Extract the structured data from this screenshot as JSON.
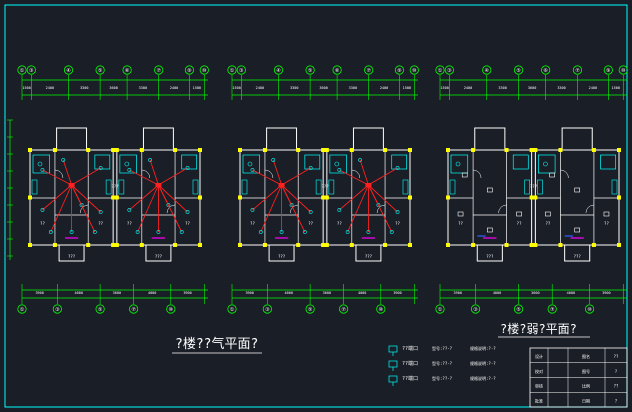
{
  "drawing": {
    "titles": {
      "electrical": "?楼??气平面?",
      "weak": "?楼?弱?平面?"
    },
    "top_axis_labels": [
      "①",
      "③",
      "④",
      "⑤",
      "⑥",
      "⑦",
      "⑨",
      "⑩"
    ],
    "bottom_axis_labels": [
      "①",
      "③",
      "⑤",
      "⑦",
      "⑩"
    ],
    "top_dims": [
      "1500",
      "2400",
      "3300",
      "3600",
      "3300",
      "2400",
      "1500"
    ],
    "bottom_dims": [
      "3900",
      "4000",
      "3600",
      "4000",
      "3900"
    ],
    "room_labels": [
      "??",
      "??",
      "??",
      "???",
      "???",
      "??"
    ],
    "center_label": "???",
    "legend": [
      {
        "code": "??端口",
        "spec": "型号:??-?",
        "note": "规格说明:?-?"
      },
      {
        "code": "??端口",
        "spec": "型号:??-?",
        "note": "规格说明:?-?"
      },
      {
        "code": "??端口",
        "spec": "型号:??-?",
        "note": "规格说明:?-?"
      }
    ],
    "title_block": {
      "rows": [
        "设计",
        "校对",
        "审核",
        "批准"
      ],
      "cells": [
        "图名",
        "图号",
        "比例",
        "日期"
      ],
      "values": [
        "??",
        "?",
        "??",
        "?"
      ]
    },
    "colors": {
      "background": "#1a1e26",
      "axis": "#00ff00",
      "wall": "#ffffff",
      "column": "#ffff00",
      "wiring": "#ff2020",
      "fixture": "#00ffff",
      "frame": "#00ffff",
      "door": "#ff00ff"
    }
  }
}
